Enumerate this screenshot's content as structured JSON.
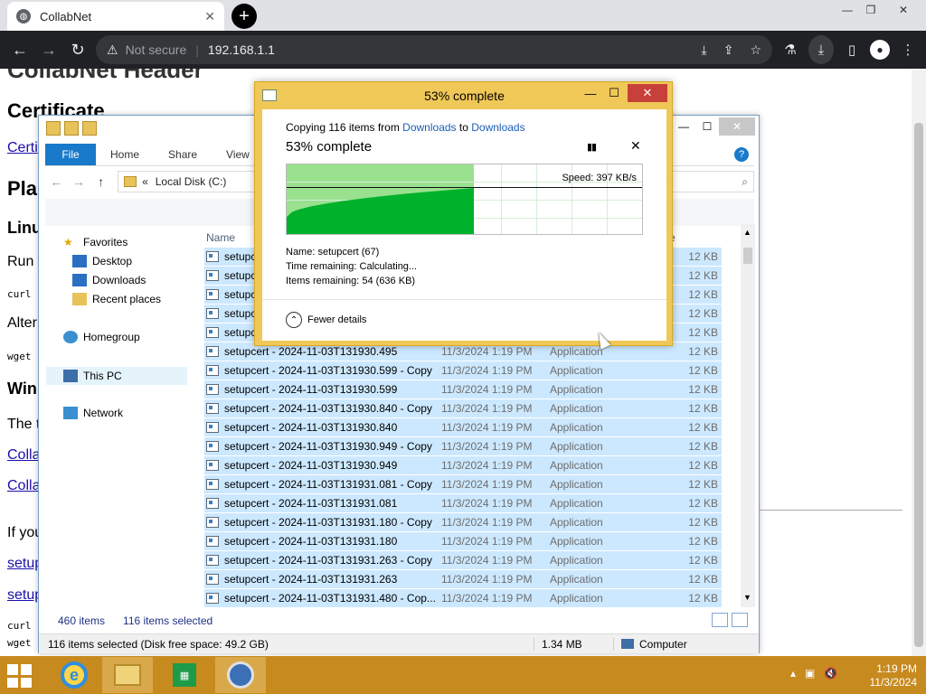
{
  "browser": {
    "tab_title": "CollabNet",
    "tab_favicon": "globe-icon",
    "address_warning": "Not secure",
    "url": "192.168.1.1",
    "accent_color": "#202124"
  },
  "webpage": {
    "heading_cut": "CollabNet Header",
    "certificate_heading": "Certificate",
    "cert_link": "Certi",
    "platform_heading": "Pla",
    "linux_heading": "Linu",
    "run_text": "Run",
    "curl1": "curl",
    "alter_text": "Alter",
    "wget1": "wget",
    "win_heading": "Win",
    "the_text": "The t",
    "colla1": "Colla",
    "colla2": "Colla",
    "ifyou_text": "If you",
    "setup1": "setup",
    "setup2": "setup",
    "curl2": "curl",
    "wget2": "wget"
  },
  "explorer": {
    "ribbon_tabs": [
      "File",
      "Home",
      "Share",
      "View"
    ],
    "address_prefix": "«",
    "address": "Local Disk (C:)",
    "nav_items": {
      "favorites": "Favorites",
      "desktop": "Desktop",
      "downloads": "Downloads",
      "recent": "Recent places",
      "homegroup": "Homegroup",
      "thispc": "This PC",
      "network": "Network"
    },
    "col_name": "Name",
    "col_size_partial": "e",
    "rows": [
      {
        "name": "setupc",
        "date": "",
        "type": "",
        "size": "12 KB"
      },
      {
        "name": "setupc",
        "date": "",
        "type": "",
        "size": "12 KB"
      },
      {
        "name": "setupc",
        "date": "",
        "type": "",
        "size": "12 KB"
      },
      {
        "name": "setupc",
        "date": "",
        "type": "",
        "size": "12 KB"
      },
      {
        "name": "setupc",
        "date": "",
        "type": "",
        "size": "12 KB"
      },
      {
        "name": "setupcert - 2024-11-03T131930.495",
        "date": "11/3/2024 1:19 PM",
        "type": "Application",
        "size": "12 KB"
      },
      {
        "name": "setupcert - 2024-11-03T131930.599 - Copy",
        "date": "11/3/2024 1:19 PM",
        "type": "Application",
        "size": "12 KB"
      },
      {
        "name": "setupcert - 2024-11-03T131930.599",
        "date": "11/3/2024 1:19 PM",
        "type": "Application",
        "size": "12 KB"
      },
      {
        "name": "setupcert - 2024-11-03T131930.840 - Copy",
        "date": "11/3/2024 1:19 PM",
        "type": "Application",
        "size": "12 KB"
      },
      {
        "name": "setupcert - 2024-11-03T131930.840",
        "date": "11/3/2024 1:19 PM",
        "type": "Application",
        "size": "12 KB"
      },
      {
        "name": "setupcert - 2024-11-03T131930.949 - Copy",
        "date": "11/3/2024 1:19 PM",
        "type": "Application",
        "size": "12 KB"
      },
      {
        "name": "setupcert - 2024-11-03T131930.949",
        "date": "11/3/2024 1:19 PM",
        "type": "Application",
        "size": "12 KB"
      },
      {
        "name": "setupcert - 2024-11-03T131931.081 - Copy",
        "date": "11/3/2024 1:19 PM",
        "type": "Application",
        "size": "12 KB"
      },
      {
        "name": "setupcert - 2024-11-03T131931.081",
        "date": "11/3/2024 1:19 PM",
        "type": "Application",
        "size": "12 KB"
      },
      {
        "name": "setupcert - 2024-11-03T131931.180 - Copy",
        "date": "11/3/2024 1:19 PM",
        "type": "Application",
        "size": "12 KB"
      },
      {
        "name": "setupcert - 2024-11-03T131931.180",
        "date": "11/3/2024 1:19 PM",
        "type": "Application",
        "size": "12 KB"
      },
      {
        "name": "setupcert - 2024-11-03T131931.263 - Copy",
        "date": "11/3/2024 1:19 PM",
        "type": "Application",
        "size": "12 KB"
      },
      {
        "name": "setupcert - 2024-11-03T131931.263",
        "date": "11/3/2024 1:19 PM",
        "type": "Application",
        "size": "12 KB"
      },
      {
        "name": "setupcert - 2024-11-03T131931.480 - Cop...",
        "date": "11/3/2024 1:19 PM",
        "type": "Application",
        "size": "12 KB"
      }
    ],
    "item_count": "460 items",
    "selected_count": "116 items selected",
    "status_selected": "116 items selected (Disk free space: 49.2 GB)",
    "status_size": "1.34 MB",
    "status_location": "Computer",
    "selection_color": "#cce8ff"
  },
  "copy_dialog": {
    "title": "53% complete",
    "copying_prefix": "Copying 116 items from ",
    "from": "Downloads",
    "to_word": " to ",
    "to": "Downloads",
    "progress_text": "53% complete",
    "progress_percent": 53,
    "speed": "Speed: 397 KB/s",
    "name_line": "Name:  setupcert (67)",
    "time_line": "Time remaining:  Calculating...",
    "items_line": "Items remaining:  54 (636 KB)",
    "fewer_details": "Fewer details",
    "pause_icon": "pause-icon",
    "close_icon": "close-icon",
    "graph_fill_color": "#00b12b",
    "graph_bg_color": "#99e08f",
    "frame_color": "#f0c858"
  },
  "taskbar": {
    "apps": [
      "start-icon",
      "internet-explorer-icon",
      "file-explorer-icon",
      "store-icon",
      "globe-icon"
    ],
    "time": "1:19 PM",
    "date": "11/3/2024",
    "color": "#c78a1f"
  }
}
